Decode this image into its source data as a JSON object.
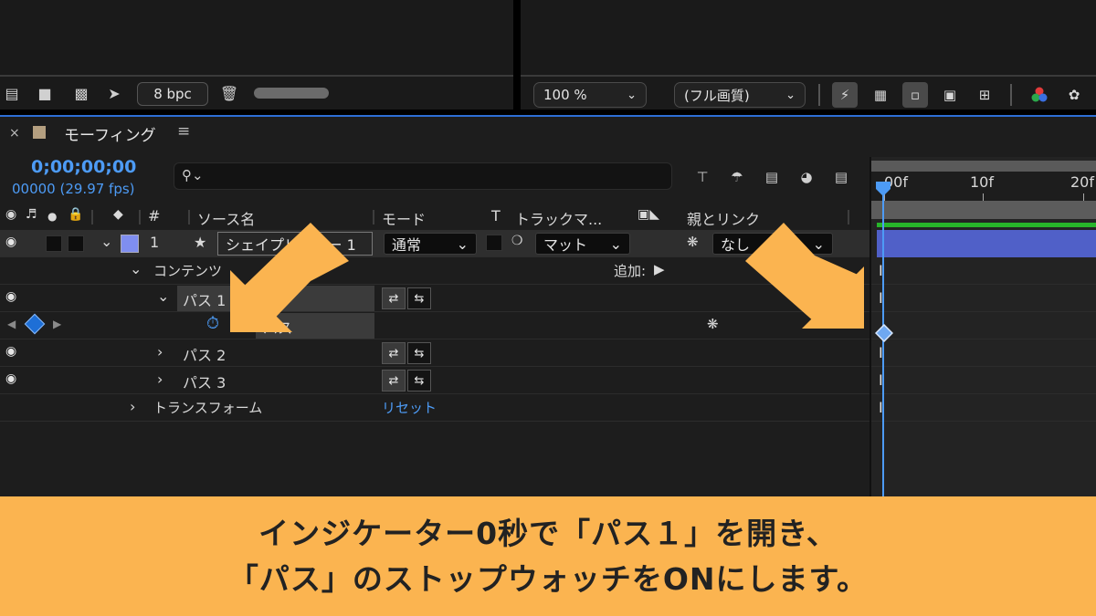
{
  "project_toolbar": {
    "bpc": "8 bpc"
  },
  "viewer_toolbar": {
    "zoom": "100 %",
    "resolution": "(フル画質)"
  },
  "comp_tab": {
    "close": "×",
    "title": "モーフィング",
    "menu": "≡"
  },
  "timecode": {
    "time": "0;00;00;00",
    "frames": "00000 (29.97 fps)"
  },
  "columns": {
    "num": "#",
    "source_name": "ソース名",
    "mode": "モード",
    "t": "T",
    "track_matte": "トラックマ...",
    "parent": "親とリンク"
  },
  "layer": {
    "index": "1",
    "name": "シェイプレイヤー 1",
    "mode": "通常",
    "matte": "マット",
    "parent": "なし"
  },
  "rows": {
    "contents": "コンテンツ",
    "add_label": "追加:",
    "path1": "パス 1",
    "path_prop": "パス",
    "path2": "パス 2",
    "path3": "パス 3",
    "transform": "トランスフォーム",
    "reset": "リセット"
  },
  "timeline": {
    "ticks": [
      "00f",
      "10f",
      "20f"
    ]
  },
  "caption": {
    "line1": "インジケーター0秒で「パス１」を開き、",
    "line2": "「パス」のストップウォッチをONにします。"
  },
  "colors": {
    "accent_blue": "#4d9bf5",
    "caption_bg": "#fbb450",
    "arrow": "#fbb450",
    "layer_label": "#7f8ef0",
    "work_bar": "#27b52a"
  }
}
